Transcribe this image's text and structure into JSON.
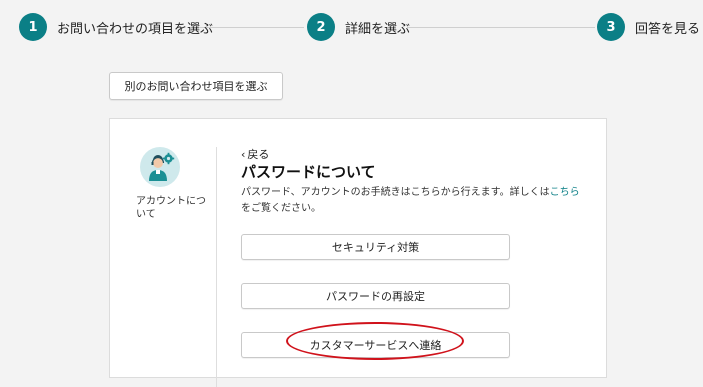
{
  "stepper": {
    "steps": [
      {
        "number": "1",
        "label": "お問い合わせの項目を選ぶ"
      },
      {
        "number": "2",
        "label": "詳細を選ぶ"
      },
      {
        "number": "3",
        "label": "回答を見る"
      }
    ]
  },
  "choose_button": {
    "label": "別のお問い合わせ項目を選ぶ"
  },
  "category": {
    "label": "アカウントについて",
    "icon": "support-agent-gear-icon"
  },
  "content": {
    "back_label": "戻る",
    "title": "パスワードについて",
    "description_before": "パスワード、アカウントのお手続きはこちらから行えます。詳しくは",
    "description_link": "こちら",
    "description_after": "をご覧ください。",
    "options": [
      {
        "label": "セキュリティ対策"
      },
      {
        "label": "パスワードの再設定"
      },
      {
        "label": "カスタマーサービスへ連絡"
      }
    ]
  },
  "colors": {
    "accent": "#0b7f86",
    "annotation": "#d0121b",
    "background": "#f3f3f3"
  }
}
